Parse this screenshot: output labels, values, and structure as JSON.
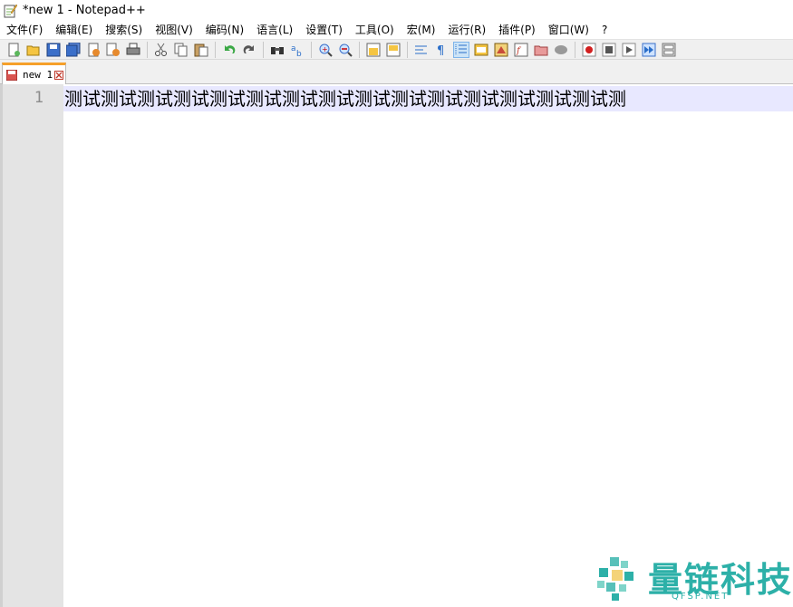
{
  "window": {
    "title": "*new 1 - Notepad++"
  },
  "menubar": {
    "items": [
      {
        "label": "文件(F)"
      },
      {
        "label": "编辑(E)"
      },
      {
        "label": "搜索(S)"
      },
      {
        "label": "视图(V)"
      },
      {
        "label": "编码(N)"
      },
      {
        "label": "语言(L)"
      },
      {
        "label": "设置(T)"
      },
      {
        "label": "工具(O)"
      },
      {
        "label": "宏(M)"
      },
      {
        "label": "运行(R)"
      },
      {
        "label": "插件(P)"
      },
      {
        "label": "窗口(W)"
      },
      {
        "label": "?"
      }
    ]
  },
  "toolbar": {
    "icons": [
      "new-file",
      "open-file",
      "save",
      "save-all",
      "close",
      "close-all",
      "print",
      "cut",
      "copy",
      "paste",
      "undo",
      "redo",
      "find",
      "replace",
      "zoom-in",
      "zoom-out",
      "sync-vertical",
      "sync-horizontal",
      "word-wrap",
      "show-all-chars",
      "indent-guide",
      "doc-map",
      "function-list",
      "folder-workspace",
      "monitor",
      "macro-record",
      "macro-stop",
      "macro-play",
      "macro-run-multiple",
      "macro-save"
    ],
    "active_icon": "indent-guide"
  },
  "tabs": [
    {
      "label": "new 1",
      "modified": true
    }
  ],
  "editor": {
    "line_number": "1",
    "line_text": "测试测试测试测试测试测试测试测试测试测试测试测试测试测试测试测",
    "current_line_color": "#e8e8ff"
  },
  "watermark": {
    "text": "量链科技",
    "sub": "QFSP.NET",
    "color": "#2db0a8"
  },
  "colors": {
    "tab_accent": "#f6a02a",
    "gutter": "#e4e4e4",
    "toolbar_bg": "#f0f0f0"
  }
}
